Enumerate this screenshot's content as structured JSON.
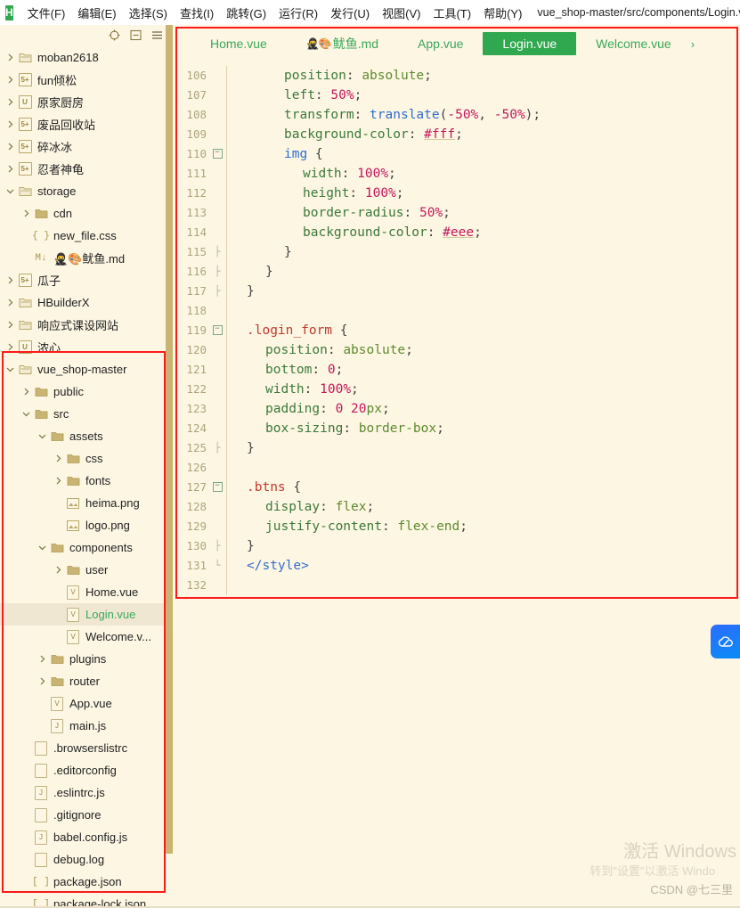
{
  "app": {
    "logo_letter": "H",
    "window_path": "vue_shop-master/src/components/Login.vu..."
  },
  "menu": {
    "items": [
      {
        "label": "文件(F)"
      },
      {
        "label": "编辑(E)"
      },
      {
        "label": "选择(S)"
      },
      {
        "label": "查找(I)"
      },
      {
        "label": "跳转(G)"
      },
      {
        "label": "运行(R)"
      },
      {
        "label": "发行(U)"
      },
      {
        "label": "视图(V)"
      },
      {
        "label": "工具(T)"
      },
      {
        "label": "帮助(Y)"
      }
    ]
  },
  "sidebar": {
    "toolbar": [
      {
        "name": "locate-file-icon",
        "glyph": "⊕"
      },
      {
        "name": "collapse-all-icon",
        "glyph": "⊟"
      },
      {
        "name": "menu-icon",
        "glyph": "☰"
      }
    ],
    "items": [
      {
        "label": "moban2618",
        "indent": 0,
        "arrow": "collapsed",
        "icon": "folder",
        "selected": false
      },
      {
        "label": "fun倾松",
        "indent": 0,
        "arrow": "collapsed",
        "icon": "badge5plus",
        "selected": false
      },
      {
        "label": "原家厨房",
        "indent": 0,
        "arrow": "collapsed",
        "icon": "badgeU",
        "selected": false
      },
      {
        "label": "废品回收站",
        "indent": 0,
        "arrow": "collapsed",
        "icon": "badge5plus",
        "selected": false
      },
      {
        "label": "碎冰冰",
        "indent": 0,
        "arrow": "collapsed",
        "icon": "badge5plus",
        "selected": false
      },
      {
        "label": "忍者神龟",
        "indent": 0,
        "arrow": "collapsed",
        "icon": "badge5plus",
        "selected": false
      },
      {
        "label": "storage",
        "indent": 0,
        "arrow": "expanded",
        "icon": "folder",
        "selected": false
      },
      {
        "label": "cdn",
        "indent": 1,
        "arrow": "collapsed",
        "icon": "folderdark",
        "selected": false
      },
      {
        "label": "new_file.css",
        "indent": 1,
        "arrow": "none",
        "icon": "css",
        "selected": false
      },
      {
        "label": "🥷🎨鱿鱼.md",
        "indent": 1,
        "arrow": "none",
        "icon": "md",
        "selected": false
      },
      {
        "label": "瓜子",
        "indent": 0,
        "arrow": "collapsed",
        "icon": "badge5plus",
        "selected": false
      },
      {
        "label": "HBuilderX",
        "indent": 0,
        "arrow": "collapsed",
        "icon": "folder",
        "selected": false
      },
      {
        "label": "响应式课设网站",
        "indent": 0,
        "arrow": "collapsed",
        "icon": "folder",
        "selected": false
      },
      {
        "label": "浓心",
        "indent": 0,
        "arrow": "collapsed",
        "icon": "badgeU",
        "selected": false
      },
      {
        "label": "vue_shop-master",
        "indent": 0,
        "arrow": "expanded",
        "icon": "folder",
        "selected": false
      },
      {
        "label": "public",
        "indent": 1,
        "arrow": "collapsed",
        "icon": "folderdark",
        "selected": false
      },
      {
        "label": "src",
        "indent": 1,
        "arrow": "expanded",
        "icon": "folderdark",
        "selected": false
      },
      {
        "label": "assets",
        "indent": 2,
        "arrow": "expanded",
        "icon": "folderdark",
        "selected": false
      },
      {
        "label": "css",
        "indent": 3,
        "arrow": "collapsed",
        "icon": "folderdark",
        "selected": false
      },
      {
        "label": "fonts",
        "indent": 3,
        "arrow": "collapsed",
        "icon": "folderdark",
        "selected": false
      },
      {
        "label": "heima.png",
        "indent": 3,
        "arrow": "none",
        "icon": "image",
        "selected": false
      },
      {
        "label": "logo.png",
        "indent": 3,
        "arrow": "none",
        "icon": "image",
        "selected": false
      },
      {
        "label": "components",
        "indent": 2,
        "arrow": "expanded",
        "icon": "folderdark",
        "selected": false
      },
      {
        "label": "user",
        "indent": 3,
        "arrow": "collapsed",
        "icon": "folderdark",
        "selected": false
      },
      {
        "label": "Home.vue",
        "indent": 3,
        "arrow": "none",
        "icon": "vue",
        "selected": false
      },
      {
        "label": "Login.vue",
        "indent": 3,
        "arrow": "none",
        "icon": "vue",
        "selected": true
      },
      {
        "label": "Welcome.v...",
        "indent": 3,
        "arrow": "none",
        "icon": "vue",
        "selected": false
      },
      {
        "label": "plugins",
        "indent": 2,
        "arrow": "collapsed",
        "icon": "folderdark",
        "selected": false
      },
      {
        "label": "router",
        "indent": 2,
        "arrow": "collapsed",
        "icon": "folderdark",
        "selected": false
      },
      {
        "label": "App.vue",
        "indent": 2,
        "arrow": "none",
        "icon": "vue",
        "selected": false
      },
      {
        "label": "main.js",
        "indent": 2,
        "arrow": "none",
        "icon": "js",
        "selected": false
      },
      {
        "label": ".browserslistrc",
        "indent": 1,
        "arrow": "none",
        "icon": "file",
        "selected": false
      },
      {
        "label": ".editorconfig",
        "indent": 1,
        "arrow": "none",
        "icon": "file",
        "selected": false
      },
      {
        "label": ".eslintrc.js",
        "indent": 1,
        "arrow": "none",
        "icon": "js",
        "selected": false
      },
      {
        "label": ".gitignore",
        "indent": 1,
        "arrow": "none",
        "icon": "file",
        "selected": false
      },
      {
        "label": "babel.config.js",
        "indent": 1,
        "arrow": "none",
        "icon": "js",
        "selected": false
      },
      {
        "label": "debug.log",
        "indent": 1,
        "arrow": "none",
        "icon": "file",
        "selected": false
      },
      {
        "label": "package.json",
        "indent": 1,
        "arrow": "none",
        "icon": "json",
        "selected": false
      },
      {
        "label": "package-lock.json",
        "indent": 1,
        "arrow": "none",
        "icon": "json",
        "selected": false
      }
    ]
  },
  "tabs": [
    {
      "label": "Home.vue",
      "icons": "",
      "active": false
    },
    {
      "label": "鱿鱼.md",
      "icons": "🥷🎨",
      "active": false
    },
    {
      "label": "App.vue",
      "icons": "",
      "active": false
    },
    {
      "label": "Login.vue",
      "icons": "",
      "active": true
    },
    {
      "label": "Welcome.vue",
      "icons": "",
      "active": false
    }
  ],
  "tab_overflow_glyph": "›",
  "editor": {
    "lines": [
      {
        "n": "106",
        "fold": "",
        "indent": 2,
        "tokens": [
          {
            "t": "position",
            "c": "t-prop"
          },
          {
            "t": ": ",
            "c": "t-punct"
          },
          {
            "t": "absolute",
            "c": "t-val"
          },
          {
            "t": ";",
            "c": "t-punct"
          }
        ]
      },
      {
        "n": "107",
        "fold": "",
        "indent": 2,
        "tokens": [
          {
            "t": "left",
            "c": "t-prop"
          },
          {
            "t": ": ",
            "c": "t-punct"
          },
          {
            "t": "50%",
            "c": "t-num"
          },
          {
            "t": ";",
            "c": "t-punct"
          }
        ]
      },
      {
        "n": "108",
        "fold": "",
        "indent": 2,
        "tokens": [
          {
            "t": "transform",
            "c": "t-prop"
          },
          {
            "t": ": ",
            "c": "t-punct"
          },
          {
            "t": "translate",
            "c": "t-fn"
          },
          {
            "t": "(",
            "c": "t-punct"
          },
          {
            "t": "-50%",
            "c": "t-num"
          },
          {
            "t": ", ",
            "c": "t-punct"
          },
          {
            "t": "-50%",
            "c": "t-num"
          },
          {
            "t": ");",
            "c": "t-punct"
          }
        ]
      },
      {
        "n": "109",
        "fold": "",
        "indent": 2,
        "tokens": [
          {
            "t": "background-color",
            "c": "t-prop"
          },
          {
            "t": ": ",
            "c": "t-punct"
          },
          {
            "t": "#fff",
            "c": "t-hash"
          },
          {
            "t": ";",
            "c": "t-punct"
          }
        ]
      },
      {
        "n": "110",
        "fold": "-",
        "indent": 2,
        "tokens": [
          {
            "t": "img",
            "c": "t-blue"
          },
          {
            "t": " {",
            "c": "t-punct"
          }
        ]
      },
      {
        "n": "111",
        "fold": "",
        "indent": 3,
        "tokens": [
          {
            "t": "width",
            "c": "t-prop"
          },
          {
            "t": ": ",
            "c": "t-punct"
          },
          {
            "t": "100%",
            "c": "t-num"
          },
          {
            "t": ";",
            "c": "t-punct"
          }
        ]
      },
      {
        "n": "112",
        "fold": "",
        "indent": 3,
        "tokens": [
          {
            "t": "height",
            "c": "t-prop"
          },
          {
            "t": ": ",
            "c": "t-punct"
          },
          {
            "t": "100%",
            "c": "t-num"
          },
          {
            "t": ";",
            "c": "t-punct"
          }
        ]
      },
      {
        "n": "113",
        "fold": "",
        "indent": 3,
        "tokens": [
          {
            "t": "border-radius",
            "c": "t-prop"
          },
          {
            "t": ": ",
            "c": "t-punct"
          },
          {
            "t": "50%",
            "c": "t-num"
          },
          {
            "t": ";",
            "c": "t-punct"
          }
        ]
      },
      {
        "n": "114",
        "fold": "",
        "indent": 3,
        "tokens": [
          {
            "t": "background-color",
            "c": "t-prop"
          },
          {
            "t": ": ",
            "c": "t-punct"
          },
          {
            "t": "#eee",
            "c": "t-hash"
          },
          {
            "t": ";",
            "c": "t-punct"
          }
        ]
      },
      {
        "n": "115",
        "fold": "|",
        "indent": 2,
        "tokens": [
          {
            "t": "}",
            "c": "t-punct"
          }
        ]
      },
      {
        "n": "116",
        "fold": "|",
        "indent": 1,
        "tokens": [
          {
            "t": "}",
            "c": "t-punct"
          }
        ]
      },
      {
        "n": "117",
        "fold": "|",
        "indent": 0,
        "tokens": [
          {
            "t": "}",
            "c": "t-punct"
          }
        ]
      },
      {
        "n": "118",
        "fold": "",
        "indent": 0,
        "tokens": []
      },
      {
        "n": "119",
        "fold": "-",
        "indent": 0,
        "tokens": [
          {
            "t": ".login_form",
            "c": "t-sel"
          },
          {
            "t": " {",
            "c": "t-punct"
          }
        ]
      },
      {
        "n": "120",
        "fold": "",
        "indent": 1,
        "tokens": [
          {
            "t": "position",
            "c": "t-prop"
          },
          {
            "t": ": ",
            "c": "t-punct"
          },
          {
            "t": "absolute",
            "c": "t-val"
          },
          {
            "t": ";",
            "c": "t-punct"
          }
        ]
      },
      {
        "n": "121",
        "fold": "",
        "indent": 1,
        "tokens": [
          {
            "t": "bottom",
            "c": "t-prop"
          },
          {
            "t": ": ",
            "c": "t-punct"
          },
          {
            "t": "0",
            "c": "t-num"
          },
          {
            "t": ";",
            "c": "t-punct"
          }
        ]
      },
      {
        "n": "122",
        "fold": "",
        "indent": 1,
        "tokens": [
          {
            "t": "width",
            "c": "t-prop"
          },
          {
            "t": ": ",
            "c": "t-punct"
          },
          {
            "t": "100%",
            "c": "t-num"
          },
          {
            "t": ";",
            "c": "t-punct"
          }
        ]
      },
      {
        "n": "123",
        "fold": "",
        "indent": 1,
        "tokens": [
          {
            "t": "padding",
            "c": "t-prop"
          },
          {
            "t": ": ",
            "c": "t-punct"
          },
          {
            "t": "0",
            "c": "t-num"
          },
          {
            "t": " ",
            "c": "t-punct"
          },
          {
            "t": "20",
            "c": "t-num"
          },
          {
            "t": "px",
            "c": "t-val"
          },
          {
            "t": ";",
            "c": "t-punct"
          }
        ]
      },
      {
        "n": "124",
        "fold": "",
        "indent": 1,
        "tokens": [
          {
            "t": "box-sizing",
            "c": "t-prop"
          },
          {
            "t": ": ",
            "c": "t-punct"
          },
          {
            "t": "border-box",
            "c": "t-val"
          },
          {
            "t": ";",
            "c": "t-punct"
          }
        ]
      },
      {
        "n": "125",
        "fold": "|",
        "indent": 0,
        "tokens": [
          {
            "t": "}",
            "c": "t-punct"
          }
        ]
      },
      {
        "n": "126",
        "fold": "",
        "indent": 0,
        "tokens": []
      },
      {
        "n": "127",
        "fold": "-",
        "indent": 0,
        "tokens": [
          {
            "t": ".btns",
            "c": "t-sel"
          },
          {
            "t": " {",
            "c": "t-punct"
          }
        ]
      },
      {
        "n": "128",
        "fold": "",
        "indent": 1,
        "tokens": [
          {
            "t": "display",
            "c": "t-prop"
          },
          {
            "t": ": ",
            "c": "t-punct"
          },
          {
            "t": "flex",
            "c": "t-val"
          },
          {
            "t": ";",
            "c": "t-punct"
          }
        ]
      },
      {
        "n": "129",
        "fold": "",
        "indent": 1,
        "tokens": [
          {
            "t": "justify-content",
            "c": "t-prop"
          },
          {
            "t": ": ",
            "c": "t-punct"
          },
          {
            "t": "flex-end",
            "c": "t-val"
          },
          {
            "t": ";",
            "c": "t-punct"
          }
        ]
      },
      {
        "n": "130",
        "fold": "|",
        "indent": 0,
        "tokens": [
          {
            "t": "}",
            "c": "t-punct"
          }
        ]
      },
      {
        "n": "131",
        "fold": "L",
        "indent": 0,
        "tokens": [
          {
            "t": "</style>",
            "c": "t-tag"
          }
        ]
      },
      {
        "n": "132",
        "fold": "",
        "indent": 0,
        "tokens": []
      }
    ]
  },
  "cloud_badge": {
    "name": "cloud-sync-icon"
  },
  "watermark": {
    "line1": "激活 Windows",
    "line2": "转到\"设置\"以激活 Windo",
    "credit": "CSDN @七三里"
  },
  "colors": {
    "background": "#FDF6E3",
    "accent_green": "#2FA84F",
    "tab_text": "#3aa85c",
    "annotation_red": "#FF1A1A",
    "scrollbar": "#C9B473"
  }
}
